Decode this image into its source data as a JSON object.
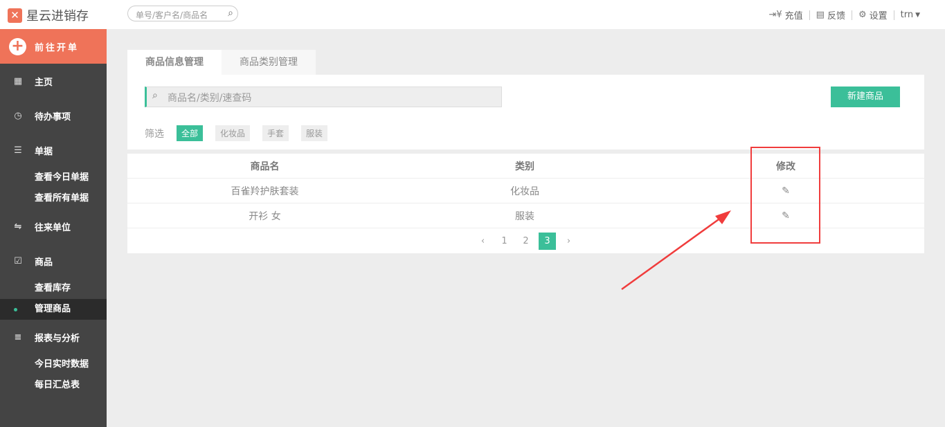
{
  "header": {
    "logo": "星云进销存",
    "search_placeholder": "单号/客户名/商品名",
    "recharge": "充值",
    "feedback": "反馈",
    "settings": "设置",
    "user": "trn"
  },
  "sidebar": {
    "new_order": "前往开单",
    "home": "主页",
    "todo": "待办事项",
    "orders": "单据",
    "orders_today": "查看今日单据",
    "orders_all": "查看所有单据",
    "partners": "往来单位",
    "goods": "商品",
    "goods_stock": "查看库存",
    "goods_manage": "管理商品",
    "reports": "报表与分析",
    "reports_realtime": "今日实时数据",
    "reports_daily": "每日汇总表"
  },
  "tabs": [
    "商品信息管理",
    "商品类别管理"
  ],
  "panel": {
    "search_placeholder": "商品名/类别/速查码",
    "new_button": "新建商品",
    "filter_label": "筛选",
    "filters": [
      "全部",
      "化妆品",
      "手套",
      "服装"
    ]
  },
  "table": {
    "headers": [
      "商品名",
      "类别",
      "修改"
    ],
    "rows": [
      [
        "百雀羚护肤套装",
        "化妆品"
      ],
      [
        "开衫 女",
        "服装"
      ]
    ]
  },
  "pager": {
    "pages": [
      "1",
      "2",
      "3"
    ],
    "current": "3"
  },
  "colors": {
    "accent": "#3bbf99",
    "brand": "#ef7359",
    "annotation": "#f03c3c"
  }
}
